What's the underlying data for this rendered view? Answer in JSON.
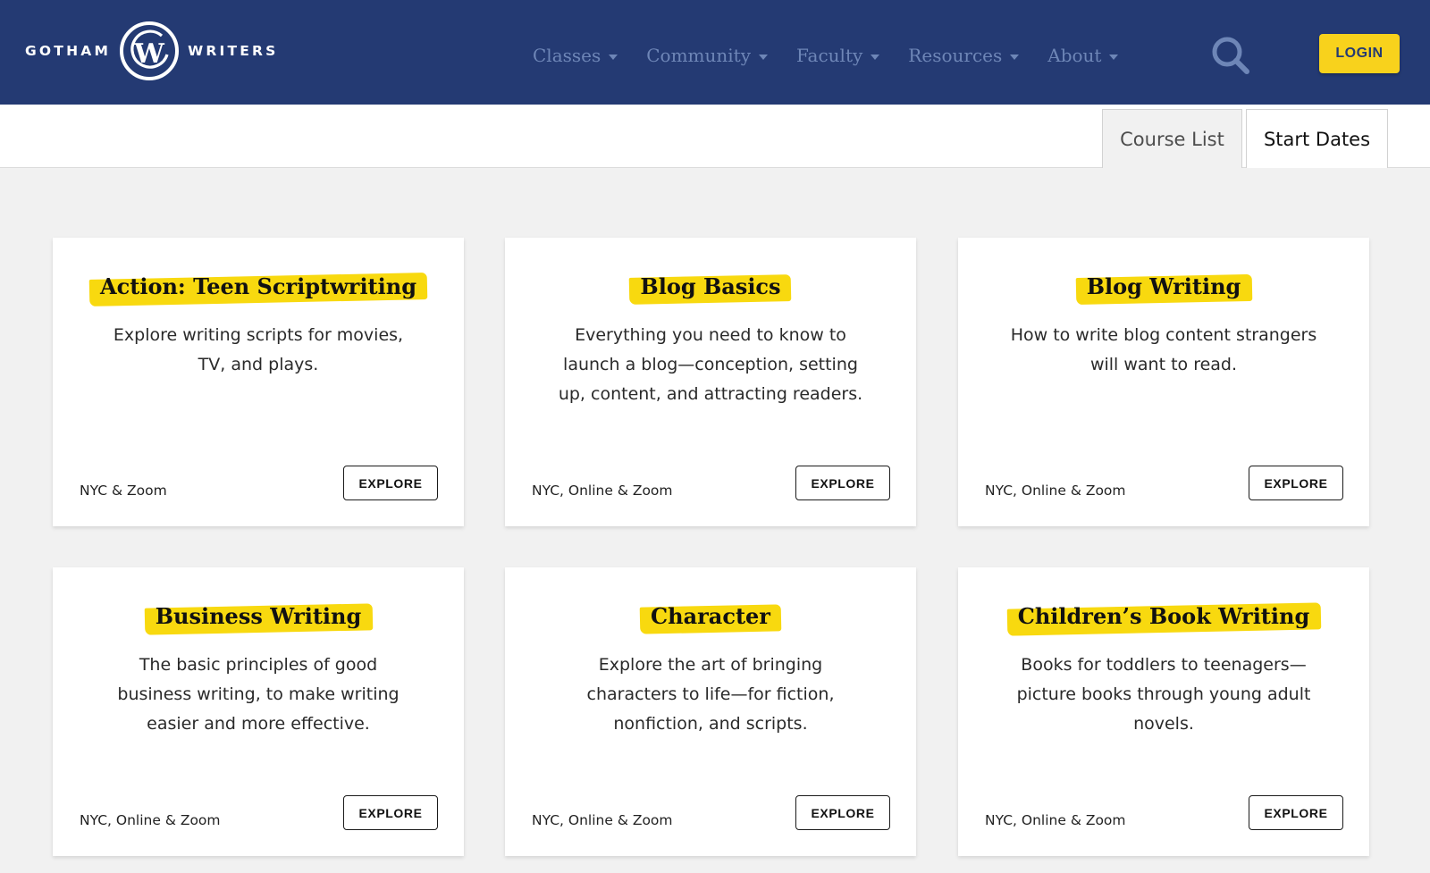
{
  "brand": {
    "left_word": "GOTHAM",
    "right_word": "WRITERS",
    "logo_letter": "W"
  },
  "nav": {
    "items": [
      {
        "label": "Classes"
      },
      {
        "label": "Community"
      },
      {
        "label": "Faculty"
      },
      {
        "label": "Resources"
      },
      {
        "label": "About"
      }
    ],
    "search_icon": "search-icon",
    "login_label": "LOGIN"
  },
  "tabs": {
    "course_list": "Course List",
    "start_dates": "Start Dates"
  },
  "colors": {
    "navy": "#243a73",
    "accent_yellow": "#f8d21c",
    "highlight": "#f8d90f",
    "nav_text": "#6e86b7"
  },
  "cards": [
    {
      "title": "Action: Teen Scriptwriting",
      "description": "Explore writing scripts for movies, TV, and plays.",
      "location": "NYC & Zoom",
      "button": "EXPLORE"
    },
    {
      "title": "Blog Basics",
      "description": "Everything you need to know to launch a blog—conception, setting up, content, and attracting readers.",
      "location": "NYC, Online & Zoom",
      "button": "EXPLORE"
    },
    {
      "title": "Blog Writing",
      "description": "How to write blog content strangers will want to read.",
      "location": "NYC, Online & Zoom",
      "button": "EXPLORE"
    },
    {
      "title": "Business Writing",
      "description": "The basic principles of good business writing, to make writing easier and more effective.",
      "location": "NYC, Online & Zoom",
      "button": "EXPLORE"
    },
    {
      "title": "Character",
      "description": "Explore the art of bringing characters to life—for fiction, nonfiction, and scripts.",
      "location": "NYC, Online & Zoom",
      "button": "EXPLORE"
    },
    {
      "title": "Children’s Book Writing",
      "description": "Books for toddlers to teenagers—picture books through young adult novels.",
      "location": "NYC, Online & Zoom",
      "button": "EXPLORE"
    }
  ]
}
